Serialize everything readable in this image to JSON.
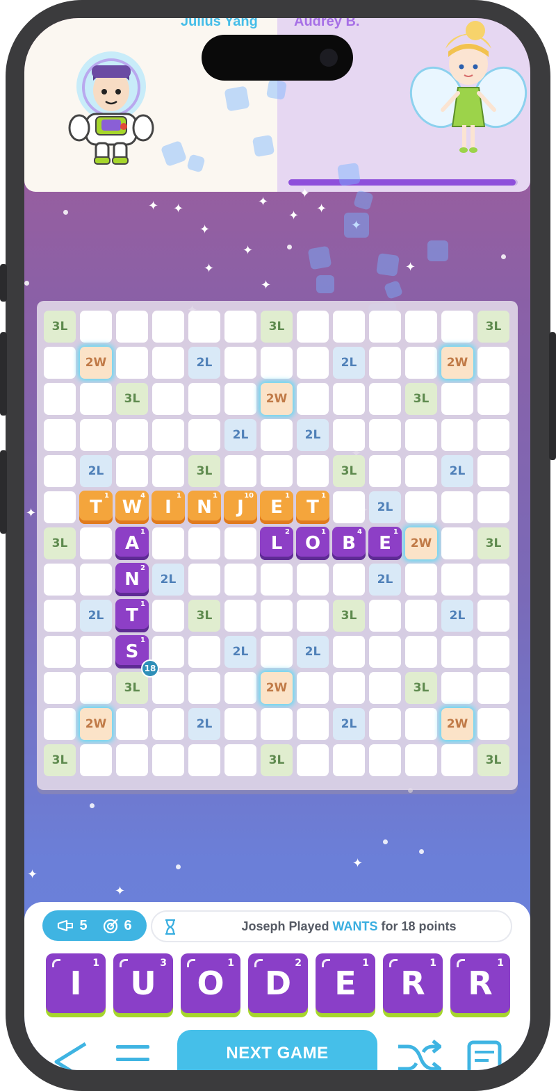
{
  "players": {
    "left_name": "Julius Yang",
    "right_name": "Audrey B.",
    "left_avatar": "space-ranger-avatar",
    "right_avatar": "fairy-avatar",
    "progress_fraction": 0.99
  },
  "board": {
    "premium_squares": [
      [
        "3L",
        0,
        0
      ],
      [
        "3L",
        0,
        6
      ],
      [
        "3L",
        0,
        12
      ],
      [
        "2W",
        1,
        1
      ],
      [
        "2L",
        1,
        4
      ],
      [
        "2L",
        1,
        8
      ],
      [
        "2W",
        1,
        11
      ],
      [
        "3L",
        2,
        2
      ],
      [
        "2W",
        2,
        6
      ],
      [
        "3L",
        2,
        10
      ],
      [
        "2L",
        3,
        5
      ],
      [
        "2L",
        3,
        7
      ],
      [
        "2L",
        4,
        1
      ],
      [
        "3L",
        4,
        4
      ],
      [
        "3L",
        4,
        8
      ],
      [
        "2L",
        4,
        11
      ],
      [
        "2L",
        5,
        9
      ],
      [
        "3L",
        6,
        0
      ],
      [
        "2W",
        6,
        10
      ],
      [
        "3L",
        6,
        12
      ],
      [
        "2L",
        7,
        3
      ],
      [
        "2L",
        7,
        9
      ],
      [
        "2L",
        8,
        1
      ],
      [
        "3L",
        8,
        4
      ],
      [
        "3L",
        8,
        8
      ],
      [
        "2L",
        8,
        11
      ],
      [
        "2L",
        9,
        5
      ],
      [
        "2L",
        9,
        7
      ],
      [
        "3L",
        10,
        2
      ],
      [
        "2W",
        10,
        6
      ],
      [
        "3L",
        10,
        10
      ],
      [
        "2W",
        11,
        1
      ],
      [
        "2L",
        11,
        4
      ],
      [
        "2L",
        11,
        8
      ],
      [
        "2W",
        11,
        11
      ],
      [
        "3L",
        12,
        0
      ],
      [
        "3L",
        12,
        6
      ],
      [
        "3L",
        12,
        12
      ]
    ],
    "placed_tiles": [
      {
        "letter": "T",
        "points": "1",
        "row": 5,
        "col": 1,
        "color": "orange"
      },
      {
        "letter": "W",
        "points": "4",
        "row": 5,
        "col": 2,
        "color": "orange"
      },
      {
        "letter": "I",
        "points": "1",
        "row": 5,
        "col": 3,
        "color": "orange"
      },
      {
        "letter": "N",
        "points": "1",
        "row": 5,
        "col": 4,
        "color": "orange"
      },
      {
        "letter": "J",
        "points": "10",
        "row": 5,
        "col": 5,
        "color": "orange"
      },
      {
        "letter": "E",
        "points": "1",
        "row": 5,
        "col": 6,
        "color": "orange"
      },
      {
        "letter": "T",
        "points": "1",
        "row": 5,
        "col": 7,
        "color": "orange"
      },
      {
        "letter": "A",
        "points": "1",
        "row": 6,
        "col": 2,
        "color": "purple"
      },
      {
        "letter": "N",
        "points": "2",
        "row": 7,
        "col": 2,
        "color": "purple"
      },
      {
        "letter": "T",
        "points": "1",
        "row": 8,
        "col": 2,
        "color": "purple"
      },
      {
        "letter": "S",
        "points": "1",
        "row": 9,
        "col": 2,
        "color": "purple"
      },
      {
        "letter": "L",
        "points": "2",
        "row": 6,
        "col": 6,
        "color": "purple"
      },
      {
        "letter": "O",
        "points": "1",
        "row": 6,
        "col": 7,
        "color": "purple"
      },
      {
        "letter": "B",
        "points": "4",
        "row": 6,
        "col": 8,
        "color": "purple"
      },
      {
        "letter": "E",
        "points": "1",
        "row": 6,
        "col": 9,
        "color": "purple"
      }
    ],
    "last_play_score": "18",
    "last_play_score_row": 9,
    "last_play_score_col": 2
  },
  "status": {
    "megaphone_count": "5",
    "target_count": "6",
    "megaphone_icon": "megaphone-icon",
    "target_icon": "target-icon",
    "hourglass_icon": "hourglass-icon",
    "message_prefix": "Joseph Played ",
    "message_word": "WANTS",
    "message_suffix": " for 18 points",
    "accent_color": "#39aee0"
  },
  "rack": [
    {
      "letter": "I",
      "points": "1"
    },
    {
      "letter": "U",
      "points": "3"
    },
    {
      "letter": "O",
      "points": "1"
    },
    {
      "letter": "D",
      "points": "2"
    },
    {
      "letter": "E",
      "points": "1"
    },
    {
      "letter": "R",
      "points": "1"
    },
    {
      "letter": "R",
      "points": "1"
    }
  ],
  "actions": {
    "next_game_label": "NEXT GAME"
  }
}
